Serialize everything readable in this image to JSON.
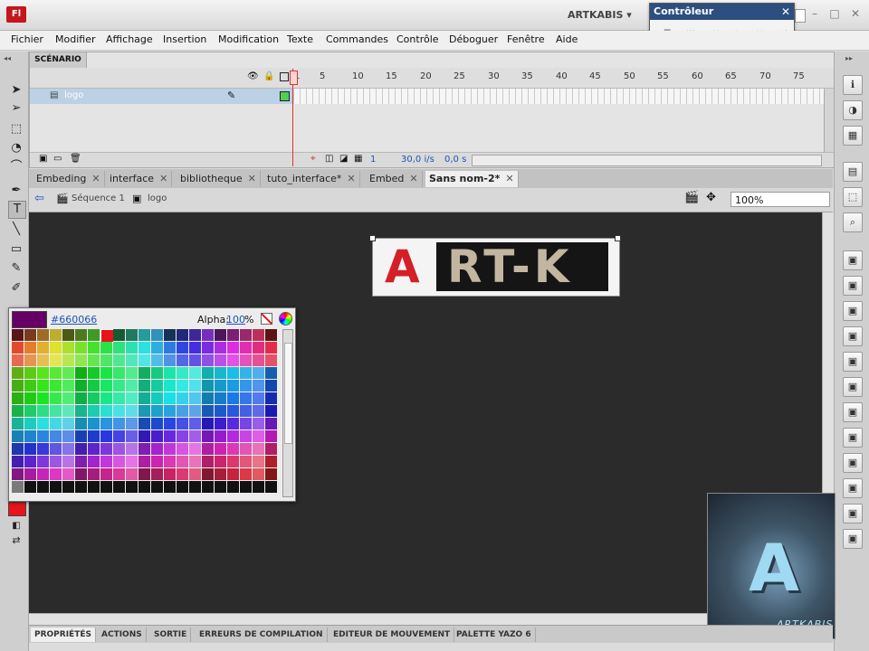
{
  "app": {
    "logo_label": "Fl",
    "workspace": "ARTKABIS ▾"
  },
  "window_controls": {
    "minimize": "–",
    "maximize": "□",
    "close": "✕"
  },
  "controleur": {
    "title": "Contrôleur",
    "close": "✕",
    "buttons": [
      "■",
      "⏮",
      "◂◂",
      "▸",
      "▸▸",
      "⏭"
    ]
  },
  "menu": [
    "Fichier",
    "Modifier",
    "Affichage",
    "Insertion",
    "Modification",
    "Texte",
    "Commandes",
    "Contrôle",
    "Déboguer",
    "Fenêtre",
    "Aide"
  ],
  "timeline": {
    "tab_label": "SCÉNARIO",
    "frame_numbers": [
      "1",
      "5",
      "10",
      "15",
      "20",
      "25",
      "30",
      "35",
      "40",
      "45",
      "50",
      "55",
      "60",
      "65",
      "70",
      "75"
    ],
    "layer_name": "logo",
    "current_frame": "1",
    "fps": "30,0 i/s",
    "time": "0,0 s"
  },
  "doc_tabs": [
    {
      "label": "Embeding",
      "active": false
    },
    {
      "label": "interface",
      "active": false
    },
    {
      "label": "bibliotheque",
      "active": false
    },
    {
      "label": "tuto_interface*",
      "active": false
    },
    {
      "label": "Embed",
      "active": false
    },
    {
      "label": "Sans nom-2*",
      "active": true
    }
  ],
  "tab_close": "✕",
  "editbar": {
    "scene": "Séquence 1",
    "symbol": "logo",
    "zoom": "100%"
  },
  "stage_logo": {
    "letter": "A",
    "rest": "RT-K",
    "accent": "#d41f27",
    "text_color": "#c3b6a1"
  },
  "picker": {
    "hex": "#660066",
    "alpha_label": "Alpha:",
    "alpha_value": "100",
    "percent": "%",
    "selected_color": "#660066"
  },
  "fill_color": "#e8141b",
  "bottom_tabs": [
    "PROPRIÉTÉS",
    "ACTIONS",
    "SORTIE",
    "ERREURS DE COMPILATION",
    "EDITEUR DE MOUVEMENT",
    "PALETTE YAZO 6"
  ],
  "watermark": {
    "letter": "A",
    "text": "ARTKABIS"
  },
  "icons": {
    "toolbar": [
      "selection-icon",
      "subselection-icon",
      "free-transform-icon",
      "3d-rotation-icon",
      "lasso-icon",
      "pen-icon",
      "text-icon",
      "line-icon",
      "rectangle-icon",
      "pencil-icon",
      "brush-icon"
    ],
    "right_panel": [
      "info-icon",
      "color-icon",
      "swatches-icon",
      "align-icon",
      "transform-icon",
      "library-icon"
    ]
  }
}
